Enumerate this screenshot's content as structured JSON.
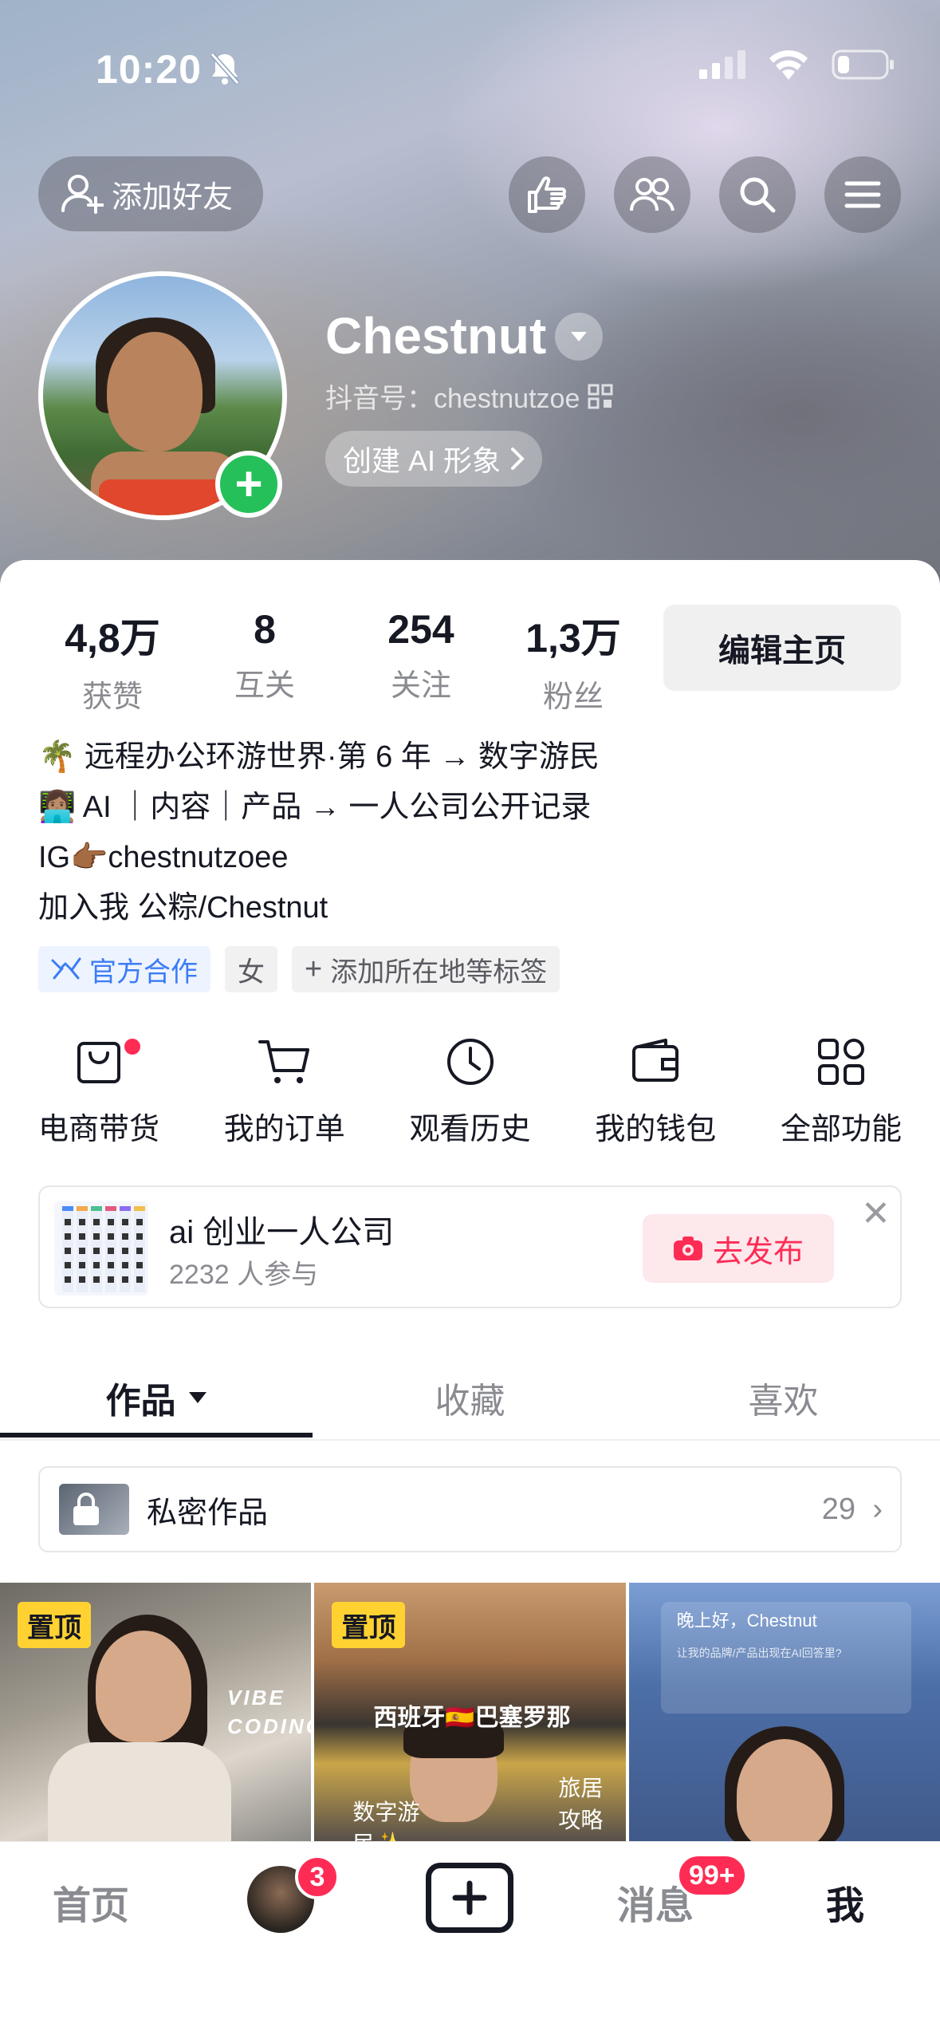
{
  "status_bar": {
    "time": "10:20"
  },
  "header": {
    "add_friend_label": "添加好友",
    "username": "Chestnut",
    "douyin_id": "抖音号：chestnutzoe",
    "create_ai_label": "创建 AI 形象"
  },
  "stats": [
    {
      "value": "4,8万",
      "label": "获赞"
    },
    {
      "value": "8",
      "label": "互关"
    },
    {
      "value": "254",
      "label": "关注"
    },
    {
      "value": "1,3万",
      "label": "粉丝"
    }
  ],
  "edit_profile_label": "编辑主页",
  "bio": [
    "🌴 远程办公环游世界·第 6 年 → 数字游民",
    "👩🏽‍💻 AI ｜内容｜产品 → 一人公司公开记录",
    "IG👉🏾chestnutzoee",
    "加入我 公粽/Chestnut"
  ],
  "tags": {
    "official": "官方合作",
    "gender": "女",
    "add_location": "添加所在地等标签"
  },
  "functions": [
    {
      "label": "电商带货",
      "icon": "bag-icon"
    },
    {
      "label": "我的订单",
      "icon": "cart-icon"
    },
    {
      "label": "观看历史",
      "icon": "clock-icon"
    },
    {
      "label": "我的钱包",
      "icon": "wallet-icon"
    },
    {
      "label": "全部功能",
      "icon": "grid-icon"
    }
  ],
  "banner": {
    "title": "ai 创业一人公司",
    "subtitle": "2232 人参与",
    "publish_label": "去发布"
  },
  "tabs": [
    {
      "label": "作品",
      "active": true
    },
    {
      "label": "收藏",
      "active": false
    },
    {
      "label": "喜欢",
      "active": false
    }
  ],
  "private_works": {
    "label": "私密作品",
    "count": "29"
  },
  "videos": [
    {
      "pinned_label": "置顶",
      "overlay": "VIBE CODING"
    },
    {
      "pinned_label": "置顶",
      "overlay": "西班牙🇪🇸巴塞罗那",
      "overlay2": "数字游民✨",
      "overlay3": "旅居攻略"
    },
    {
      "overlay": "晚上好，Chestnut",
      "overlay2": "让我的品牌/产品出现在AI回答里?"
    }
  ],
  "bottom_nav": {
    "home": "首页",
    "friends_badge": "3",
    "messages": "消息",
    "messages_badge": "99+",
    "me": "我"
  },
  "colors": {
    "accent": "#fe2c55",
    "text": "#161823",
    "muted": "#8a8b91",
    "green_plus": "#25c05a",
    "pin": "#ffd232"
  }
}
